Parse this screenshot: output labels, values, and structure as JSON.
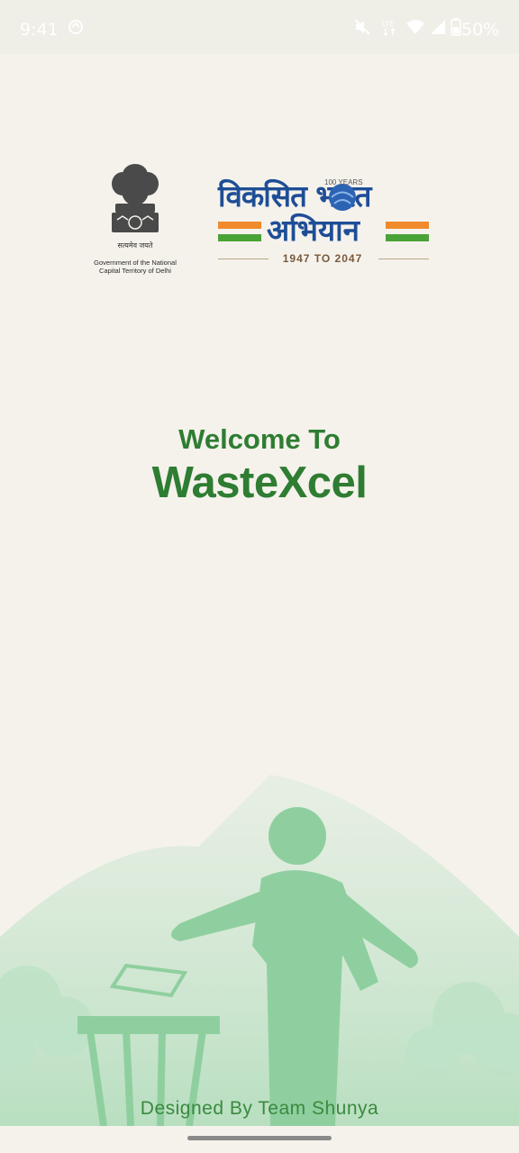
{
  "status_bar": {
    "time": "9:41",
    "battery_percent": "50%",
    "icons": [
      "sync-icon",
      "mute-icon",
      "data-icon",
      "wifi-icon",
      "signal-icon",
      "battery-icon"
    ]
  },
  "logos": {
    "emblem_motto": "सत्यमेव जयते",
    "emblem_caption_line1": "Government of the National",
    "emblem_caption_line2": "Capital Territory of Delhi",
    "vba_line1": "विकसित भारत",
    "vba_line2": "अभियान",
    "vba_badge": "100 YEARS",
    "vba_years": "1947 TO 2047"
  },
  "welcome": {
    "line1": "Welcome To",
    "app_name": "WasteXcel"
  },
  "footer": {
    "credit": "Designed By Team Shunya"
  },
  "colors": {
    "background": "#f5f2ec",
    "brand_green": "#2e7d32",
    "illustration_green": "#8fcf9f",
    "vba_blue": "#1e4e96"
  }
}
